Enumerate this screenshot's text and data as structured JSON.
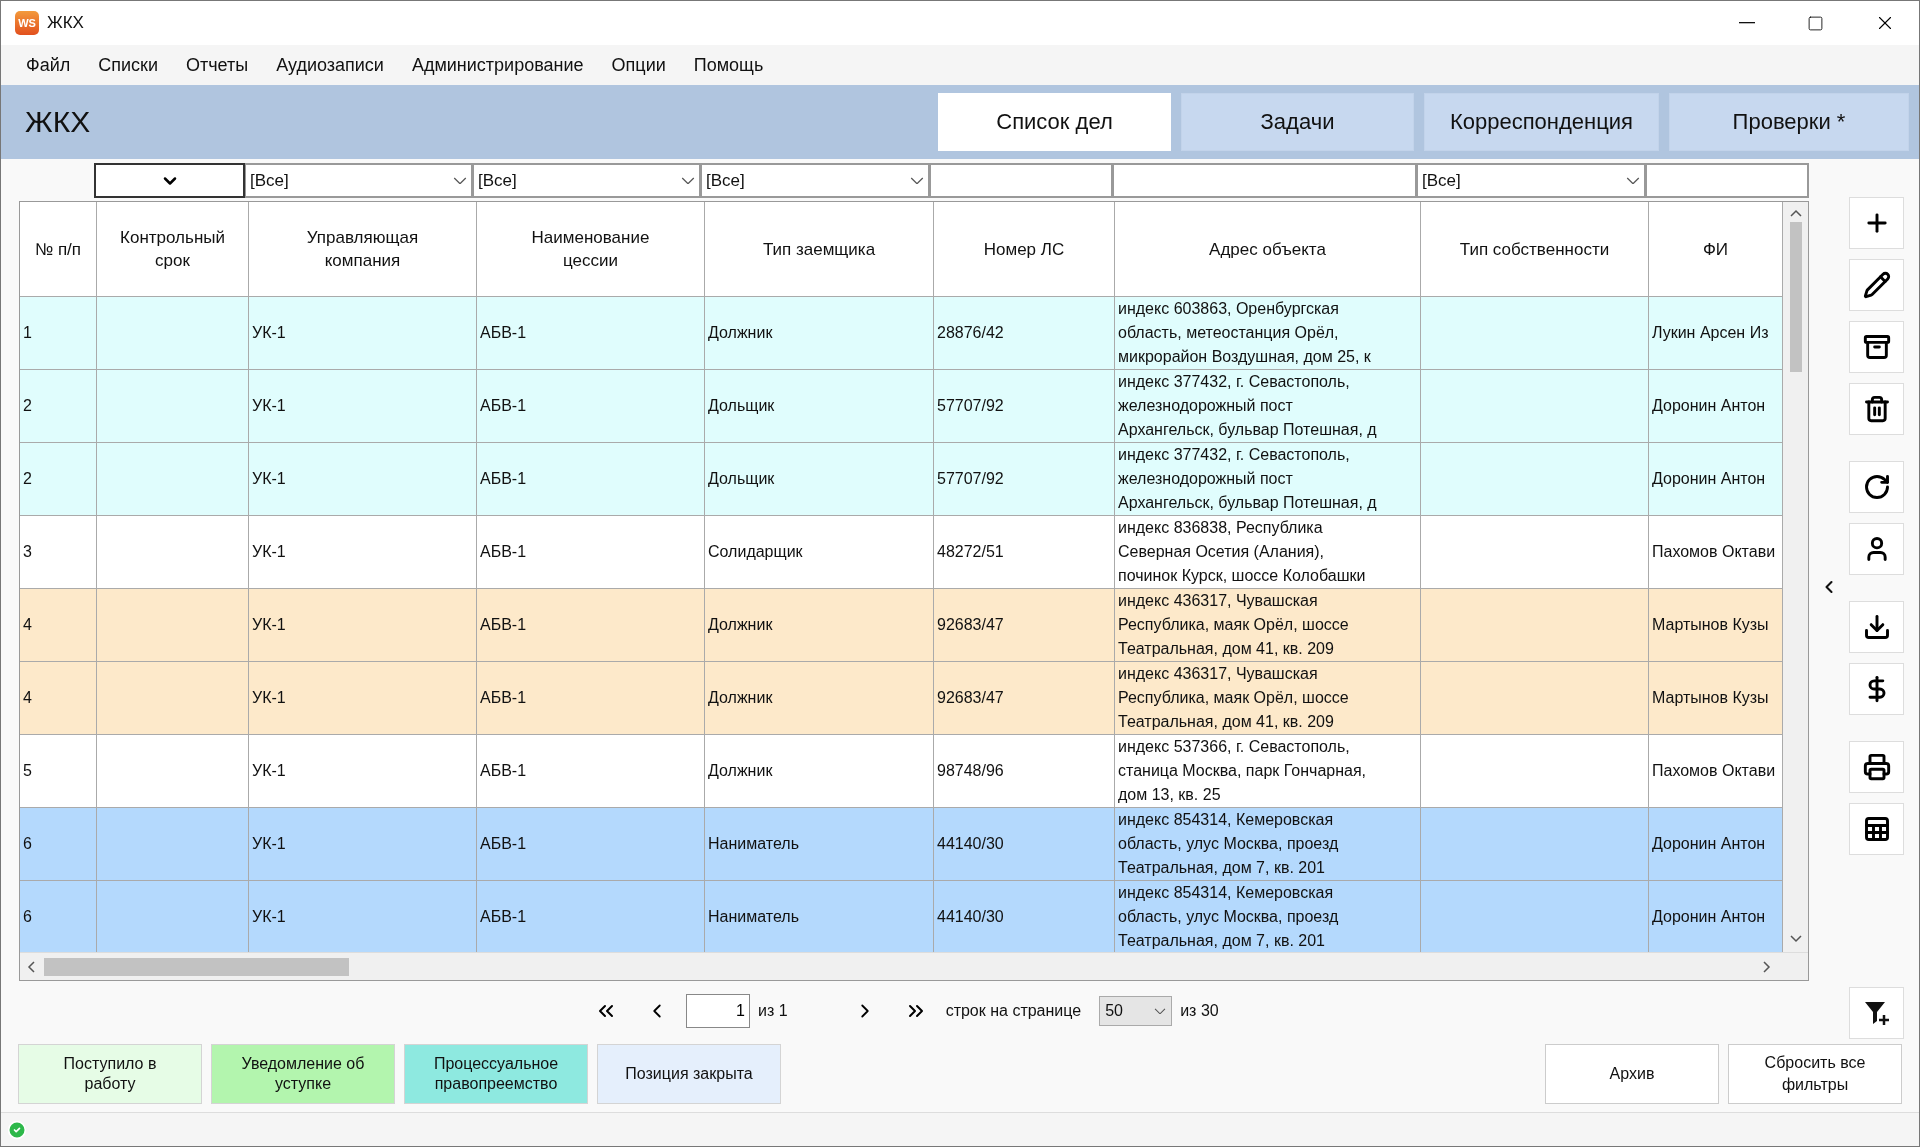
{
  "window": {
    "logo": "WS",
    "title": "ЖКХ"
  },
  "menu": [
    "Файл",
    "Списки",
    "Отчеты",
    "Аудиозаписи",
    "Администрирование",
    "Опции",
    "Помощь"
  ],
  "header": {
    "title": "ЖКХ"
  },
  "tabs": [
    {
      "label": "Список дел",
      "selected": true
    },
    {
      "label": "Задачи",
      "selected": false
    },
    {
      "label": "Корреспонденция",
      "selected": false
    },
    {
      "label": "Проверки *",
      "selected": false
    }
  ],
  "filters": [
    {
      "kind": "none"
    },
    {
      "kind": "picker"
    },
    {
      "kind": "select",
      "value": "[Все]"
    },
    {
      "kind": "select",
      "value": "[Все]"
    },
    {
      "kind": "select",
      "value": "[Все]"
    },
    {
      "kind": "text"
    },
    {
      "kind": "text"
    },
    {
      "kind": "select",
      "value": "[Все]"
    },
    {
      "kind": "text"
    }
  ],
  "table": {
    "columns": [
      "№ п/п",
      "Контрольный срок",
      "Управляющая компания",
      "Наименование цессии",
      "Тип заемщика",
      "Номер ЛС",
      "Адрес объекта",
      "Тип собственности",
      "ФИ"
    ],
    "rows": [
      {
        "color": "#e0fdfd",
        "num": "1",
        "company": "УК-1",
        "cession": "АБВ-1",
        "borrower_type": "Должник",
        "account": "28876/42",
        "address": "индекс 603863, Оренбургская\nобласть, метеостанция Орёл,\nмикрорайон Воздушная, дом 25, к",
        "name": "Лукин Арсен Из"
      },
      {
        "color": "#e0fdfd",
        "num": "2",
        "company": "УК-1",
        "cession": "АБВ-1",
        "borrower_type": "Дольщик",
        "account": "57707/92",
        "address": "индекс 377432, г. Севастополь,\nжелезнодорожный пост\nАрхангельск, бульвар Потешная, д",
        "name": "Доронин Антон"
      },
      {
        "color": "#e0fdfd",
        "num": "2",
        "company": "УК-1",
        "cession": "АБВ-1",
        "borrower_type": "Дольщик",
        "account": "57707/92",
        "address": "индекс 377432, г. Севастополь,\nжелезнодорожный пост\nАрхангельск, бульвар Потешная, д",
        "name": "Доронин Антон"
      },
      {
        "color": "#ffffff",
        "num": "3",
        "company": "УК-1",
        "cession": "АБВ-1",
        "borrower_type": "Солидарщик",
        "account": "48272/51",
        "address": "индекс 836838, Республика\nСеверная Осетия (Алания),\nпочинок Курск, шоссе Колобашки",
        "name": "Пахомов Октави"
      },
      {
        "color": "#fde9ca",
        "num": "4",
        "company": "УК-1",
        "cession": "АБВ-1",
        "borrower_type": "Должник",
        "account": "92683/47",
        "address": "индекс 436317, Чувашская\nРеспублика, маяк Орёл, шоссе\nТеатральная, дом 41, кв. 209",
        "name": "Мартынов Кузы"
      },
      {
        "color": "#fde9ca",
        "num": "4",
        "company": "УК-1",
        "cession": "АБВ-1",
        "borrower_type": "Должник",
        "account": "92683/47",
        "address": "индекс 436317, Чувашская\nРеспублика, маяк Орёл, шоссе\nТеатральная, дом 41, кв. 209",
        "name": "Мартынов Кузы"
      },
      {
        "color": "#ffffff",
        "num": "5",
        "company": "УК-1",
        "cession": "АБВ-1",
        "borrower_type": "Должник",
        "account": "98748/96",
        "address": "индекс 537366, г. Севастополь,\nстаница Москва, парк Гончарная,\nдом 13, кв. 25",
        "name": "Пахомов Октави"
      },
      {
        "color": "#b4d9fd",
        "num": "6",
        "company": "УК-1",
        "cession": "АБВ-1",
        "borrower_type": "Наниматель",
        "account": "44140/30",
        "address": "индекс 854314, Кемеровская\nобласть, улус Москва, проезд\nТеатральная, дом 7, кв. 201",
        "name": "Доронин Антон"
      },
      {
        "color": "#b4d9fd",
        "num": "6",
        "company": "УК-1",
        "cession": "АБВ-1",
        "borrower_type": "Наниматель",
        "account": "44140/30",
        "address": "индекс 854314, Кемеровская\nобласть, улус Москва, проезд\nТеатральная, дом 7, кв. 201",
        "name": "Доронин Антон"
      }
    ]
  },
  "pager": {
    "page": "1",
    "of_pages": "из 1",
    "rows_label": "строк на странице",
    "page_size": "50",
    "total": "из 30"
  },
  "legend": [
    {
      "label": "Поступило в работу",
      "color": "#e6fce6"
    },
    {
      "label": "Уведомление об уступке",
      "color": "#b3f5ae"
    },
    {
      "label": "Процессуальное правопреемство",
      "color": "#8ee9e0"
    },
    {
      "label": "Позиция закрыта",
      "color": "#e5effc"
    }
  ],
  "actions": [
    "Архив",
    "Сбросить все фильтры"
  ]
}
